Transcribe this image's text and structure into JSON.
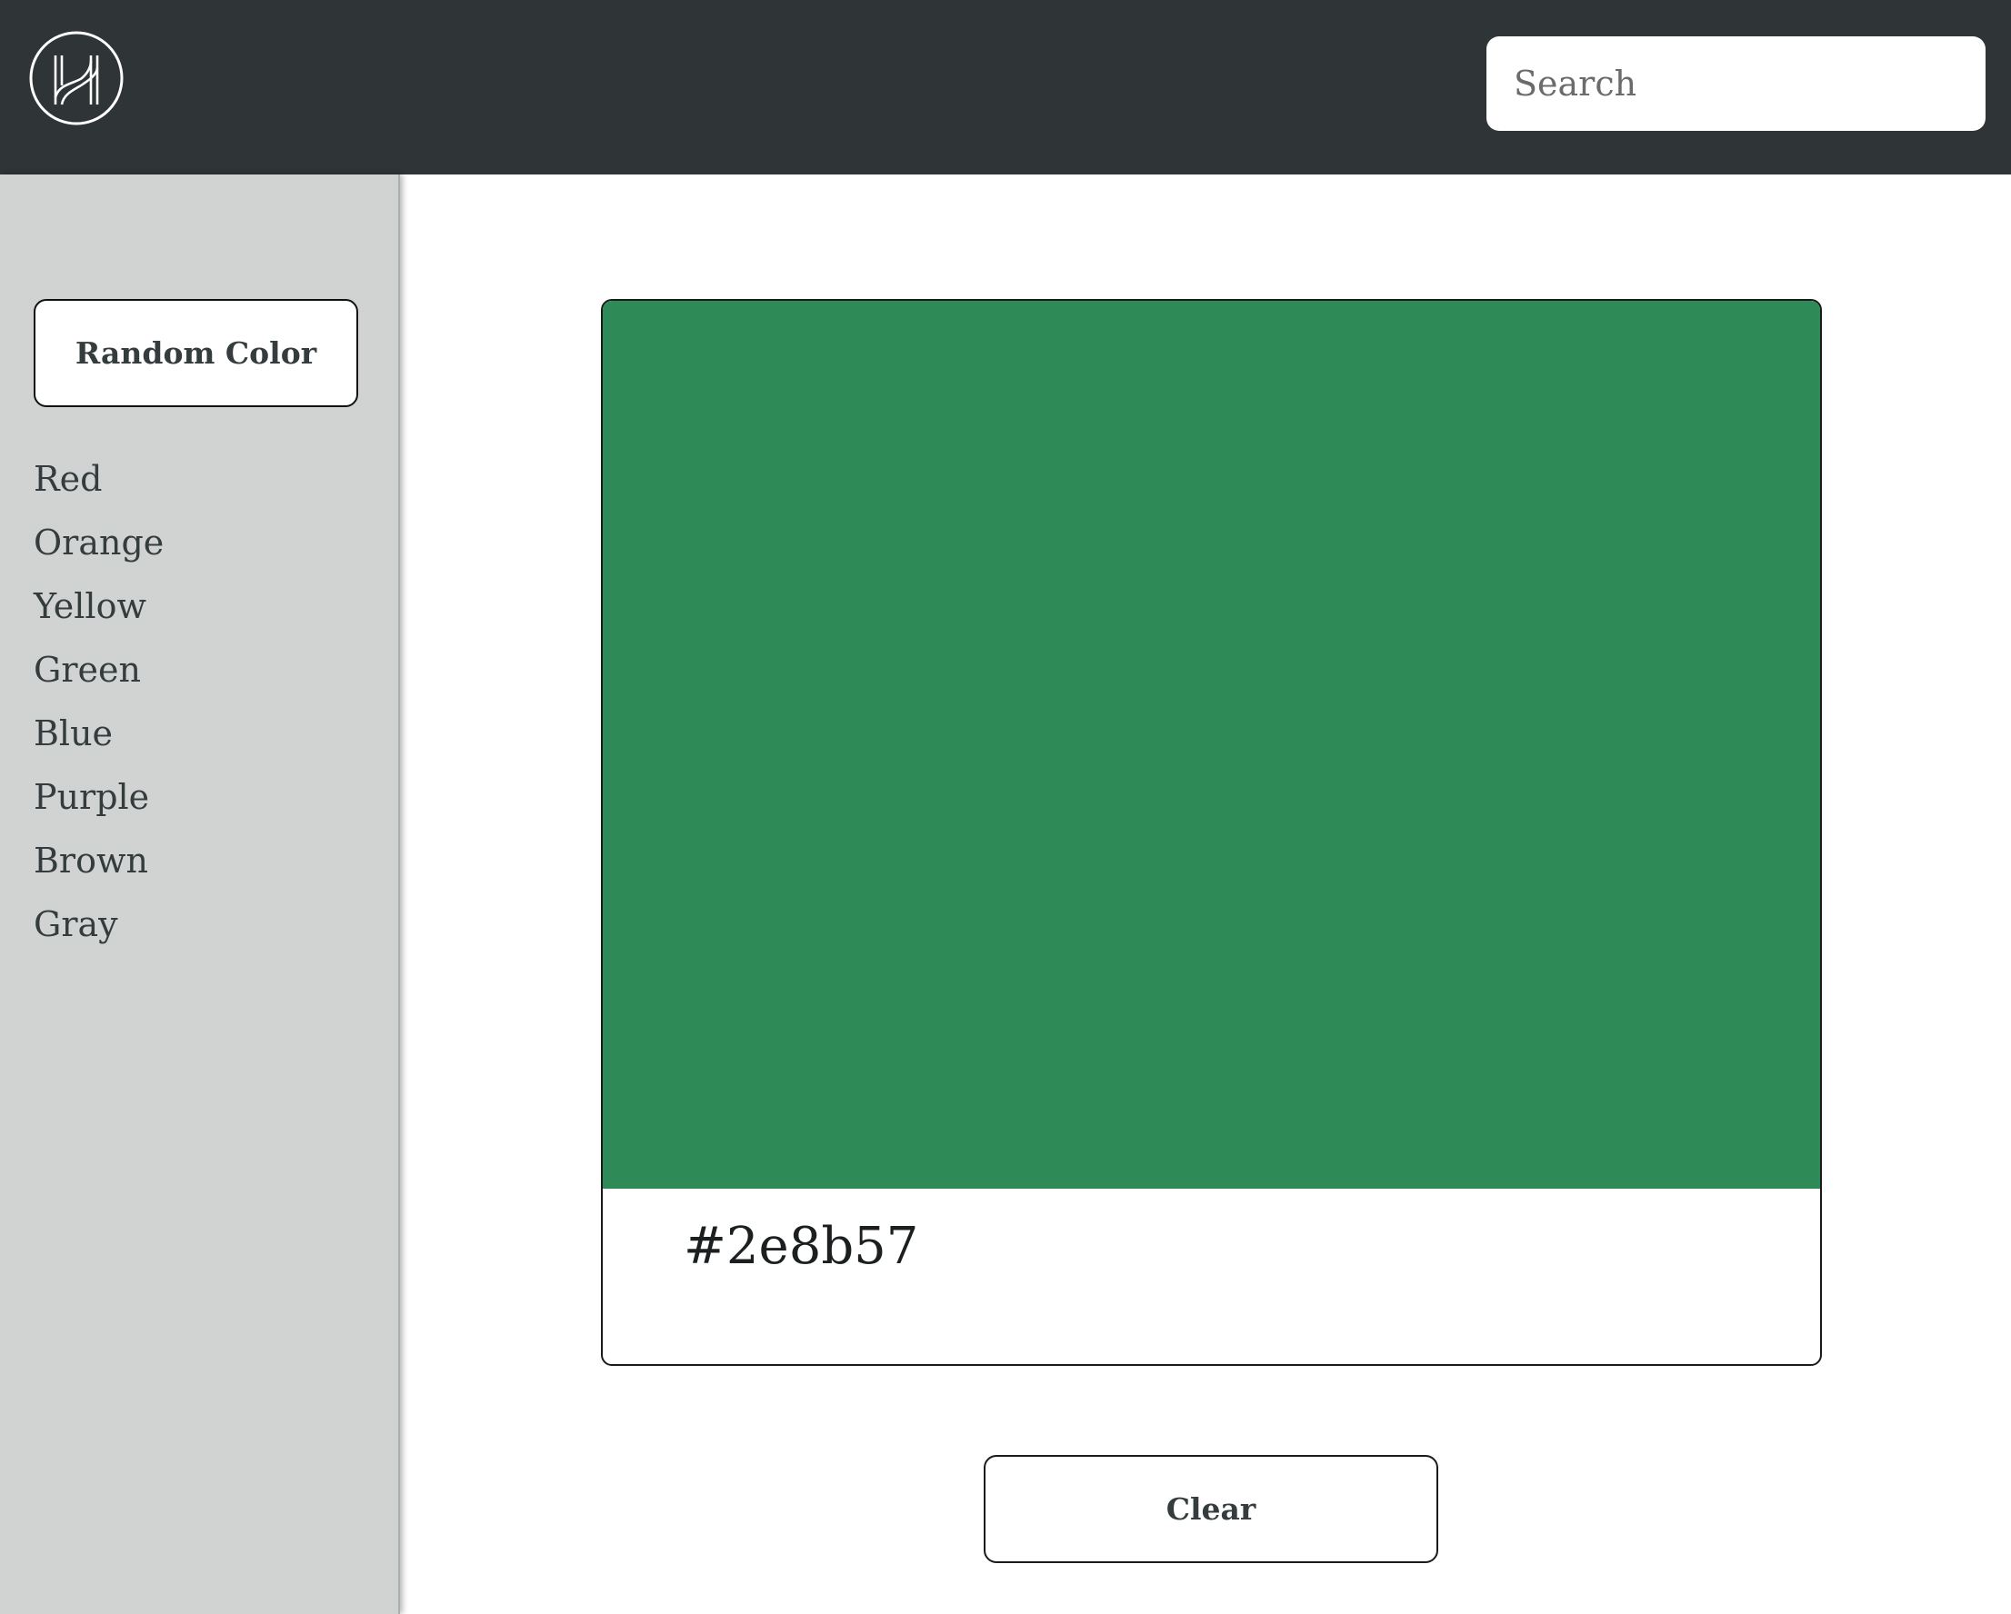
{
  "header": {
    "logo_icon": "h-monogram-logo-icon",
    "search": {
      "placeholder": "Search",
      "value": ""
    }
  },
  "sidebar": {
    "random_button_label": "Random Color",
    "colors": [
      "Red",
      "Orange",
      "Yellow",
      "Green",
      "Blue",
      "Purple",
      "Brown",
      "Gray"
    ]
  },
  "main": {
    "swatch_color": "#2e8b57",
    "hex_label": "#2e8b57",
    "clear_button_label": "Clear"
  },
  "theme": {
    "header_bg": "#2f3536",
    "sidebar_bg": "#d1d3d3",
    "text": "#353c3d"
  }
}
